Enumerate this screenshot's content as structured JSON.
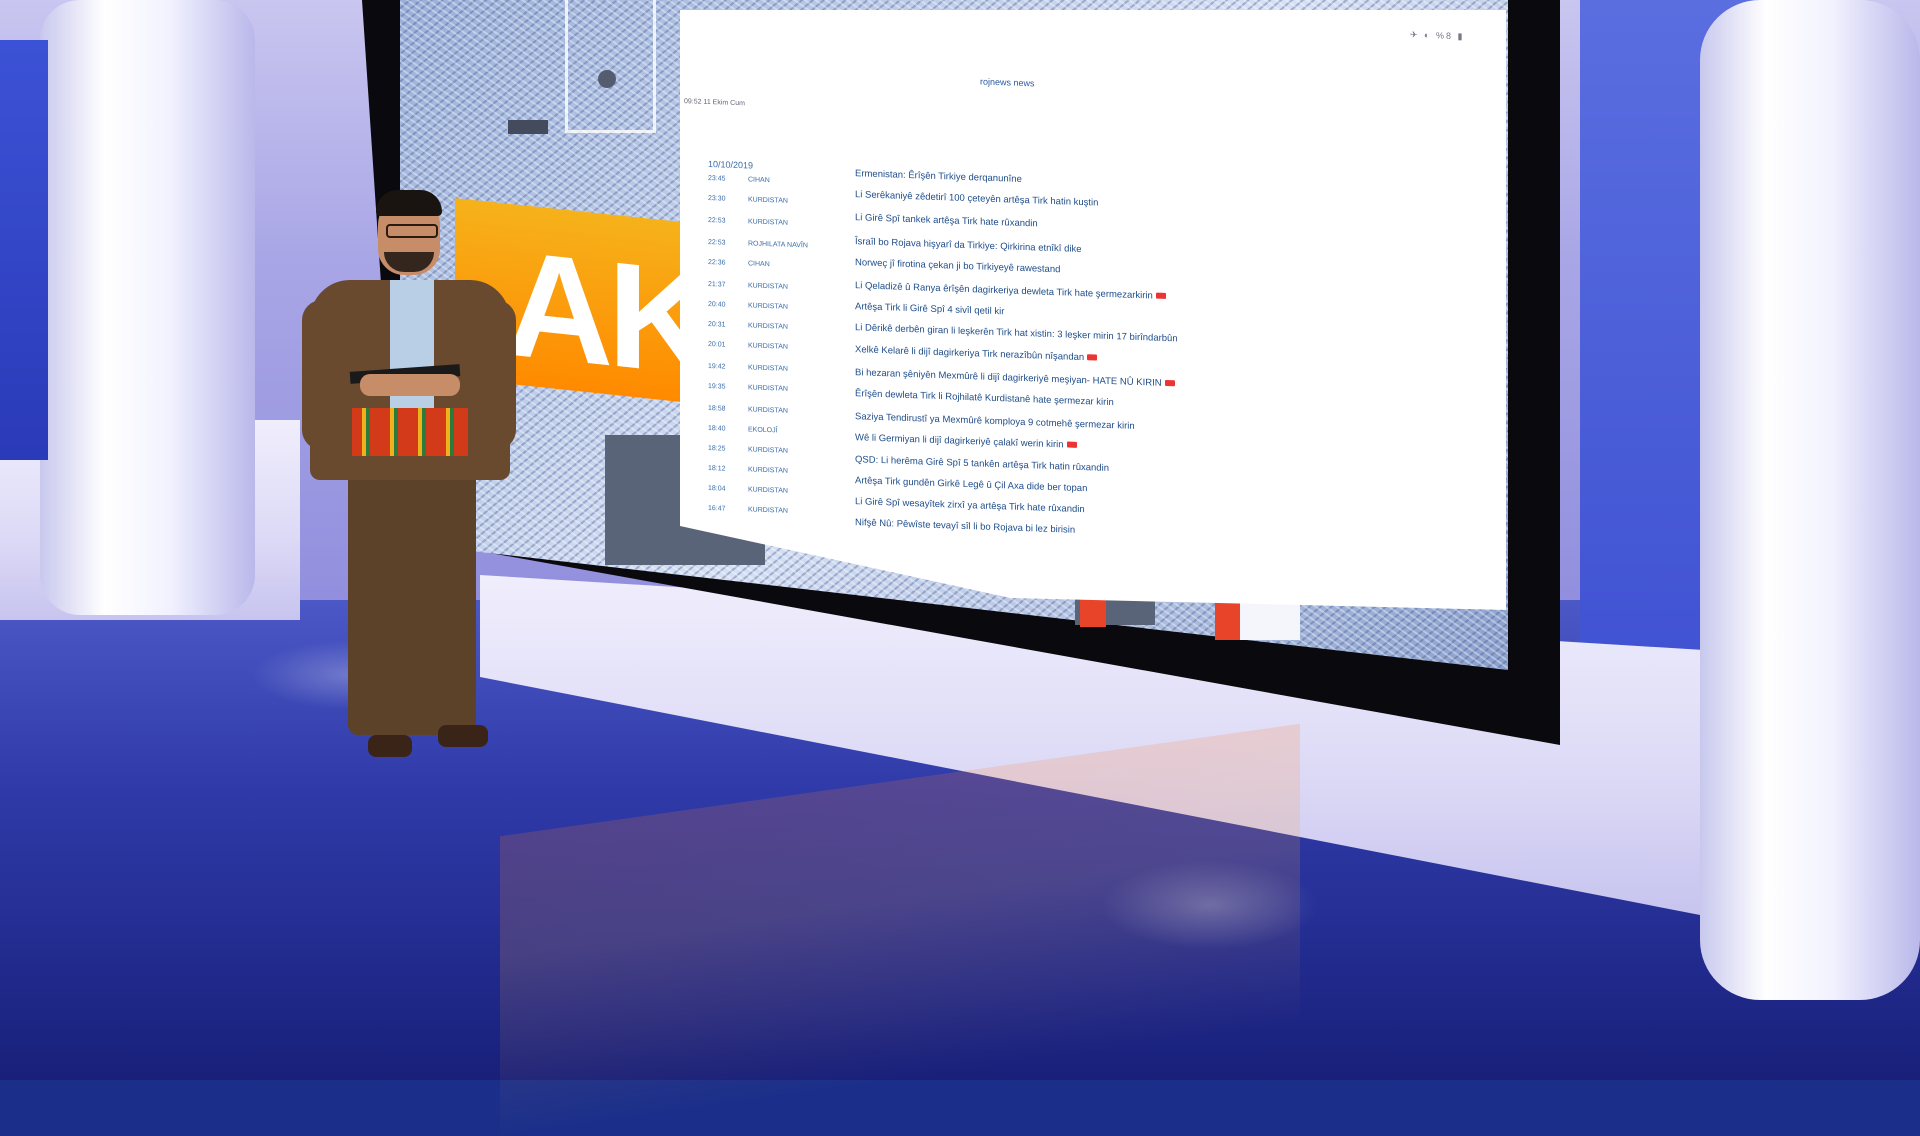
{
  "wall": {
    "banner_text": "AK"
  },
  "browser": {
    "status_left": "09:52  11 Ekim Cum",
    "site_name": "rojnews news",
    "status_right": "✈ ◐ %8 ▮",
    "date": "10/10/2019",
    "news": [
      {
        "time": "23:45",
        "cat": "CIHAN",
        "headline": "Ermenistan: Êrîşên Tirkiye derqanunîne",
        "video": false
      },
      {
        "time": "23:30",
        "cat": "KURDISTAN",
        "headline": "Li Serêkaniyê zêdetirî 100 çeteyên artêşa Tirk hatin kuştin",
        "video": false
      },
      {
        "time": "22:53",
        "cat": "KURDISTAN",
        "headline": "Li Girê Spî tankek artêşa Tirk hate rûxandin",
        "video": false
      },
      {
        "time": "22:53",
        "cat": "ROJHILATA NAVÎN",
        "headline": "Îsraîl bo Rojava hişyarî da Tirkiye: Qirkirina etnîkî dike",
        "video": false
      },
      {
        "time": "22:36",
        "cat": "CIHAN",
        "headline": "Norweç jî firotina çekan ji bo Tirkiyeyê rawestand",
        "video": false
      },
      {
        "time": "21:37",
        "cat": "KURDISTAN",
        "headline": "Li Qeladizê û Ranya êrîşên dagirkeriya dewleta Tirk hate şermezarkirin",
        "video": true
      },
      {
        "time": "20:40",
        "cat": "KURDISTAN",
        "headline": "Artêşa Tirk li Girê Spî 4 sivîl qetil kir",
        "video": false
      },
      {
        "time": "20:31",
        "cat": "KURDISTAN",
        "headline": "Li Dêrikê derbên giran li leşkerên Tirk hat xistin: 3 leşker mirin 17 birîndarbûn",
        "video": false
      },
      {
        "time": "20:01",
        "cat": "KURDISTAN",
        "headline": "Xelkê Kelarê li dijî dagirkeriya Tirk nerazîbûn nîşandan",
        "video": true
      },
      {
        "time": "19:42",
        "cat": "KURDISTAN",
        "headline": "Bi hezaran şêniyên Mexmûrê li dijî dagirkeriyê meşiyan- HATE NÛ KIRIN",
        "video": true
      },
      {
        "time": "19:35",
        "cat": "KURDISTAN",
        "headline": "Êrîşên dewleta Tirk li Rojhilatê Kurdistanê hate şermezar kirin",
        "video": false
      },
      {
        "time": "18:58",
        "cat": "KURDISTAN",
        "headline": "Saziya Tendirustî ya Mexmûrê komploya 9 cotmehê şermezar kirin",
        "video": false
      },
      {
        "time": "18:40",
        "cat": "EKOLOJÎ",
        "headline": "Wê li Germiyan li dijî dagirkeriyê çalakî werin kirin",
        "video": true
      },
      {
        "time": "18:25",
        "cat": "KURDISTAN",
        "headline": "QSD: Li herêma Girê Spî 5 tankên artêşa Tirk hatin rûxandin",
        "video": false
      },
      {
        "time": "18:12",
        "cat": "KURDISTAN",
        "headline": "Artêşa Tirk gundên Girkê Legê û Çil Axa dide ber topan",
        "video": false
      },
      {
        "time": "18:04",
        "cat": "KURDISTAN",
        "headline": "Li Girê Spî wesayîtek zirxî ya artêşa Tirk hate rûxandin",
        "video": false
      },
      {
        "time": "16:47",
        "cat": "KURDISTAN",
        "headline": "Nifşê Nû: Pêwîste tevayî sîl li bo Rojava bi lez birisin",
        "video": false
      }
    ]
  }
}
